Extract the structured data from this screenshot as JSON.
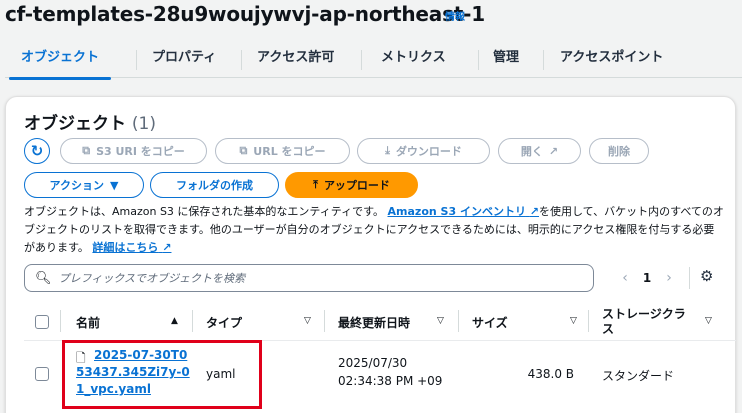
{
  "header": {
    "bucket_name": "cf-templates-28u9woujywvj-ap-northeast-1",
    "info_label": "情報"
  },
  "tabs": [
    {
      "label": "オブジェクト",
      "active": true
    },
    {
      "label": "プロパティ",
      "active": false
    },
    {
      "label": "アクセス許可",
      "active": false
    },
    {
      "label": "メトリクス",
      "active": false
    },
    {
      "label": "管理",
      "active": false
    },
    {
      "label": "アクセスポイント",
      "active": false
    }
  ],
  "objects_panel": {
    "title": "オブジェクト",
    "count": "(1)",
    "buttons": {
      "copy_s3_uri": "S3 URI をコピー",
      "copy_url": "URL をコピー",
      "download": "ダウンロード",
      "open": "開く",
      "delete": "削除",
      "actions": "アクション",
      "create_folder": "フォルダの作成",
      "upload": "アップロード"
    },
    "description": {
      "part1": "オブジェクトは、Amazon S3 に保存された基本的なエンティティです。",
      "inventory_link": "Amazon S3 インベントリ",
      "part2": "を使用して、バケット内のすべてのオブジェクトのリストを取得できます。他のユーザーが自分のオブジェクトにアクセスできるためには、明示的にアクセス権限を付与する必要があります。",
      "learn_more_link": "詳細はこちら"
    },
    "search": {
      "placeholder": "プレフィックスでオブジェクトを検索",
      "value": ""
    },
    "pagination": {
      "current_page": "1"
    },
    "table": {
      "columns": {
        "name": "名前",
        "type": "タイプ",
        "last_modified": "最終更新日時",
        "size": "サイズ",
        "storage_class": "ストレージクラス"
      },
      "rows": [
        {
          "name": "2025-07-30T053437.345Zi7y-01_vpc.yaml",
          "type": "yaml",
          "last_modified_date": "2025/07/30",
          "last_modified_time": "02:34:38 PM +09",
          "size": "438.0 B",
          "storage_class": "スタンダード"
        }
      ]
    }
  },
  "colors": {
    "accent": "#0972d3",
    "upload_button": "#ff9900",
    "highlight_box": "#e0001a"
  },
  "icons": [
    "refresh-icon",
    "copy-icon",
    "download-icon",
    "external-link-icon",
    "caret-down-icon",
    "upload-icon",
    "search-icon",
    "chevron-left-icon",
    "chevron-right-icon",
    "settings-gear-icon",
    "sort-ascending-icon",
    "sort-descending-icon",
    "file-icon"
  ]
}
